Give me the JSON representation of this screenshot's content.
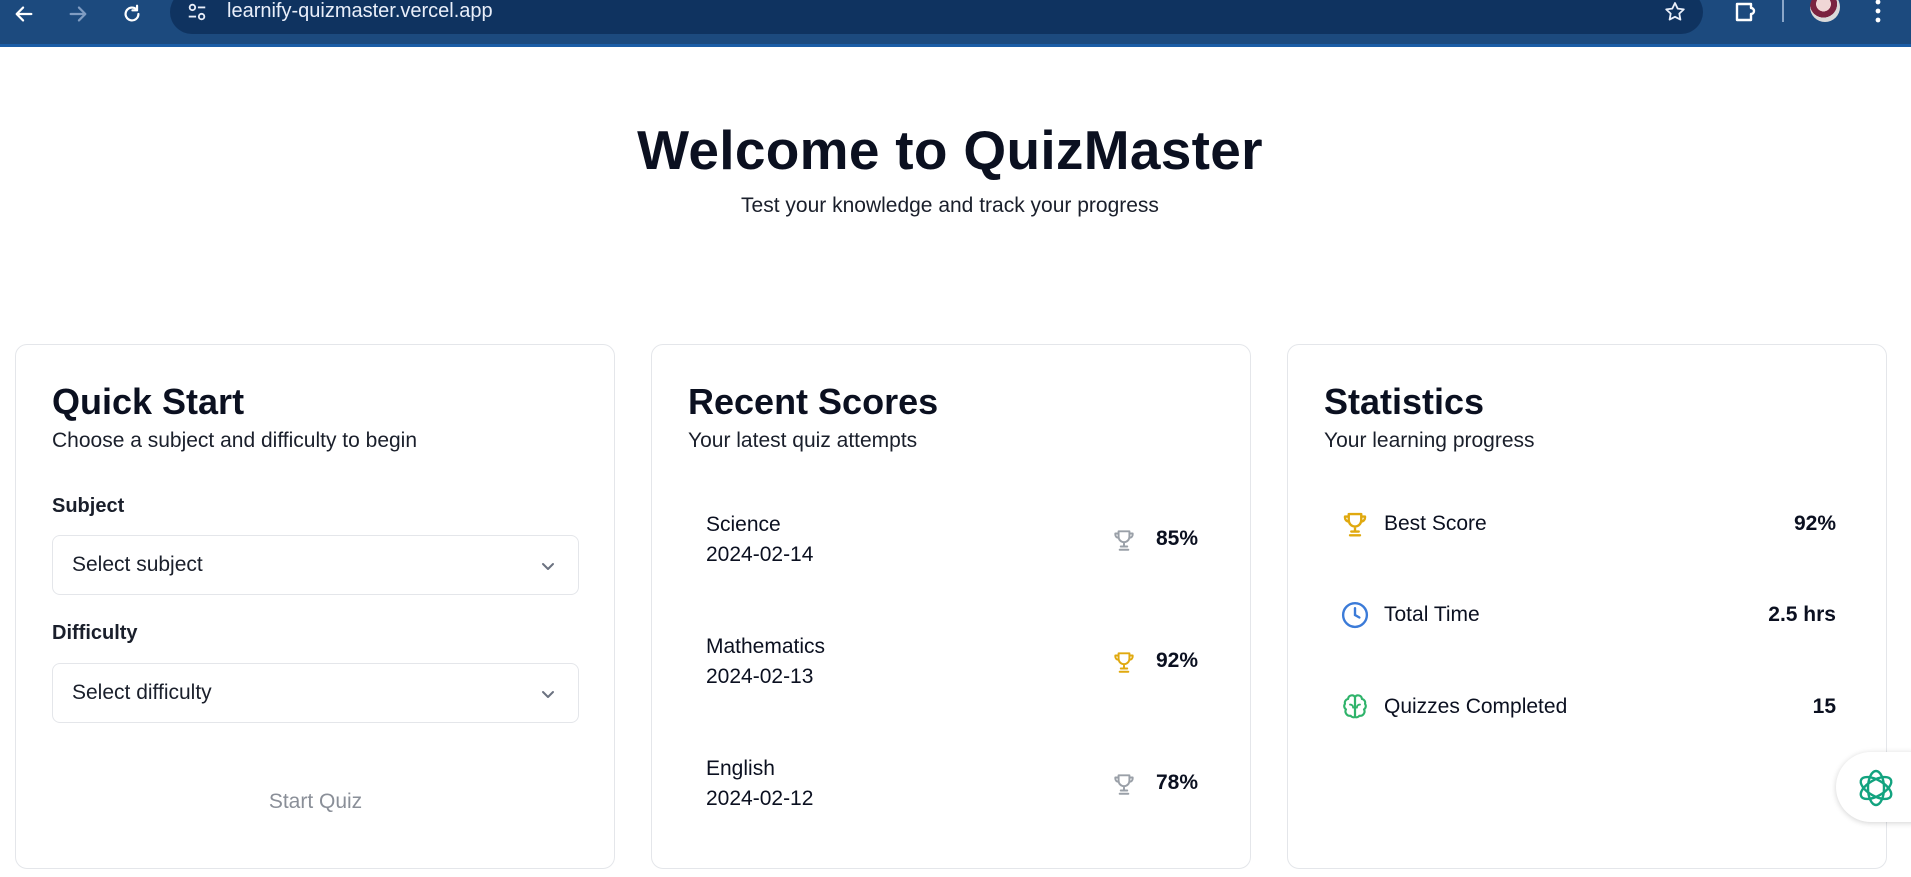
{
  "browser": {
    "url": "learnify-quizmaster.vercel.app"
  },
  "hero": {
    "title": "Welcome to QuizMaster",
    "subtitle": "Test your knowledge and track your progress"
  },
  "quick_start": {
    "title": "Quick Start",
    "description": "Choose a subject and difficulty to begin",
    "subject_label": "Subject",
    "subject_value": "Select subject",
    "difficulty_label": "Difficulty",
    "difficulty_value": "Select difficulty",
    "start_label": "Start Quiz"
  },
  "recent_scores": {
    "title": "Recent Scores",
    "description": "Your latest quiz attempts",
    "items": [
      {
        "subject": "Science",
        "date": "2024-02-14",
        "score": "85%",
        "icon": "trophy-icon",
        "icon_color": "#9aa0a8"
      },
      {
        "subject": "Mathematics",
        "date": "2024-02-13",
        "score": "92%",
        "icon": "trophy-icon",
        "icon_color": "#e0a90f"
      },
      {
        "subject": "English",
        "date": "2024-02-12",
        "score": "78%",
        "icon": "trophy-icon",
        "icon_color": "#9aa0a8"
      }
    ]
  },
  "statistics": {
    "title": "Statistics",
    "description": "Your learning progress",
    "items": [
      {
        "label": "Best Score",
        "value": "92%",
        "icon": "trophy-icon",
        "icon_color": "#e0a90f"
      },
      {
        "label": "Total Time",
        "value": "2.5 hrs",
        "icon": "clock-icon",
        "icon_color": "#3b7bd8"
      },
      {
        "label": "Quizzes Completed",
        "value": "15",
        "icon": "brain-icon",
        "icon_color": "#2fb36a"
      }
    ]
  },
  "colors": {
    "browser_bar": "#1c4a7e",
    "border": "#e4e6ea",
    "gold": "#e0a90f",
    "gray_trophy": "#9aa0a8"
  }
}
